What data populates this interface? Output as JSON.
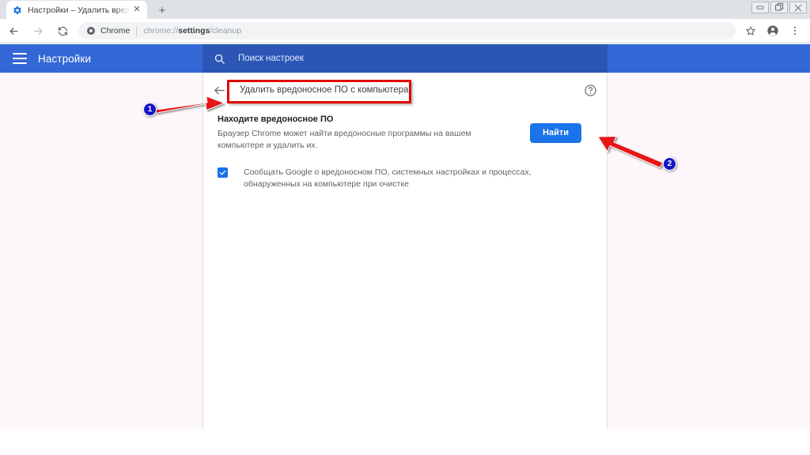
{
  "browser": {
    "tab": {
      "favicon": "gear-icon",
      "title": "Настройки – Удалить вредонос",
      "close_label": "✕"
    },
    "new_tab_label": "+",
    "window_controls": {
      "minimize": "▭",
      "restore": "❐",
      "close": "✕"
    },
    "nav": {
      "back": "←",
      "forward": "→",
      "reload": "⟳"
    },
    "omnibox": {
      "site_label": "Chrome",
      "url_prefix": "chrome://",
      "url_bold": "settings",
      "url_suffix": "/cleanup",
      "full_url": "chrome://settings/cleanup"
    },
    "toolbar_icons": [
      "bookmark-star-icon",
      "profile-avatar-icon",
      "more-menu-icon"
    ]
  },
  "settings_header": {
    "menu_icon": "hamburger-menu-icon",
    "title": "Настройки",
    "search": {
      "icon": "search-icon",
      "placeholder": "Поиск настроек",
      "value": ""
    }
  },
  "page": {
    "back_icon": "back-arrow-icon",
    "title": "Удалить вредоносное ПО с компьютера",
    "help_icon": "help-circle-icon",
    "cleanup": {
      "heading": "Находите вредоносное ПО",
      "description": "Браузер Chrome может найти вредоносные программы на вашем компьютере и удалить их.",
      "button_label": "Найти"
    },
    "report": {
      "checked": true,
      "label": "Сообщать Google о вредоносном ПО, системных настройках и процессах, обнаруженных на компьютере при очистке"
    }
  },
  "annotations": {
    "marker_1": "1",
    "marker_2": "2",
    "highlight_color": "#e00000",
    "marker_color": "#1515c8"
  },
  "theme": {
    "accent_blue": "#1a73e8",
    "header_blue": "#3367d6",
    "search_blue": "#2b56b5",
    "page_tint": "#fdf7fc"
  }
}
